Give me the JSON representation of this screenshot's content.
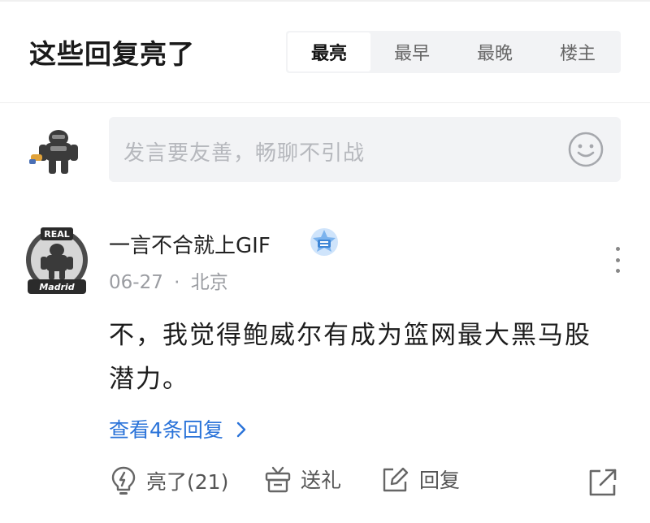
{
  "header": {
    "title": "这些回复亮了",
    "tabs": [
      {
        "label": "最亮",
        "active": true
      },
      {
        "label": "最早",
        "active": false
      },
      {
        "label": "最晚",
        "active": false
      },
      {
        "label": "楼主",
        "active": false
      }
    ]
  },
  "compose": {
    "placeholder": "发言要友善，畅聊不引战",
    "emoji_icon": "smiley-icon"
  },
  "comment": {
    "username": "一言不合就上GIF",
    "date": "06-27",
    "separator": "·",
    "location": "北京",
    "text": "不，我觉得鲍威尔有成为篮网最大黑马股潜力。",
    "view_replies": "查看4条回复",
    "avatar_badge_top": "REAL",
    "avatar_badge_bottom": "Madrid",
    "actions": {
      "like": "亮了(21)",
      "gift": "送礼",
      "reply": "回复"
    }
  },
  "colors": {
    "link": "#2a73d9",
    "muted": "#9a9ca1",
    "input_bg": "#f2f3f5"
  }
}
